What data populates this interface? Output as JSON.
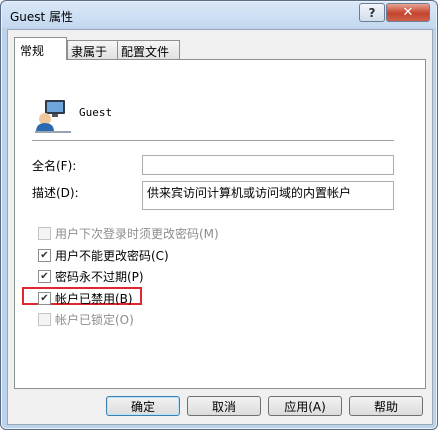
{
  "window": {
    "title": "Guest 属性",
    "help": "?",
    "close": "✕"
  },
  "tabs": [
    {
      "label": "常规"
    },
    {
      "label": "隶属于"
    },
    {
      "label": "配置文件"
    }
  ],
  "user": {
    "name": "Guest"
  },
  "fields": {
    "fullname_label": "全名(F):",
    "fullname_value": "",
    "description_label": "描述(D):",
    "description_value": "供来宾访问计算机或访问域的内置帐户"
  },
  "options": [
    {
      "label": "用户下次登录时须更改密码(M)",
      "checked": false,
      "enabled": false
    },
    {
      "label": "用户不能更改密码(C)",
      "checked": true,
      "enabled": true
    },
    {
      "label": "密码永不过期(P)",
      "checked": true,
      "enabled": true
    },
    {
      "label": "帐户已禁用(B)",
      "checked": true,
      "enabled": true
    },
    {
      "label": "帐户已锁定(O)",
      "checked": false,
      "enabled": false
    }
  ],
  "buttons": {
    "ok": "确定",
    "cancel": "取消",
    "apply": "应用(A)",
    "help": "帮助"
  },
  "colors": {
    "highlight_box": "#e0262e",
    "title_bar": "#c3d8ef",
    "close_button": "#c3432b"
  }
}
